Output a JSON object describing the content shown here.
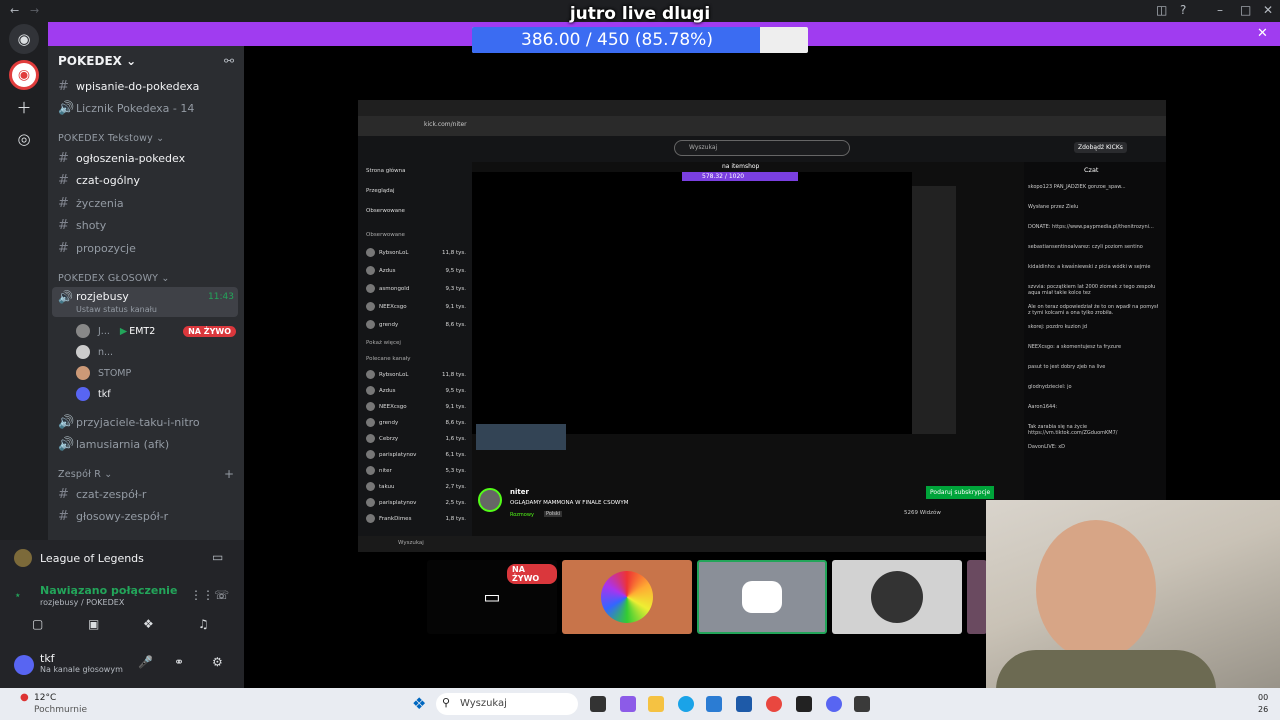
{
  "stream": {
    "title": "jutro live dlugi",
    "progress_text": "386.00 / 450 (85.78%)",
    "progress_fraction": 0.8578,
    "banner_color": "#a03cf0",
    "bar_color": "#3b6cf2",
    "overlay_tag": "POKEDEX"
  },
  "discord": {
    "server_name": "POKEDEX",
    "channels_top": [
      {
        "name": "wpisanie-do-pokedexa",
        "icon": "hash-icon"
      },
      {
        "name": "Licznik Pokedexa - 14",
        "icon": "voice-icon"
      }
    ],
    "text_category": "POKEDEX Tekstowy",
    "text_channels": [
      "ogłoszenia-pokedex",
      "czat-ogólny",
      "życzenia",
      "shoty",
      "propozycje"
    ],
    "voice_category": "POKEDEX GŁOSOWY",
    "voice_channel": {
      "name": "rozjebusy",
      "time": "11:43",
      "status": "Ustaw status kanału"
    },
    "voice_users": [
      {
        "name": "J...",
        "activity": "EMT2",
        "live": "NA ŻYWO"
      },
      {
        "name": "n..."
      },
      {
        "name": "STOMP"
      },
      {
        "name": "tkf"
      }
    ],
    "other_voice": [
      "przyjaciele-taku-i-nitro",
      "lamusiarnia (afk)"
    ],
    "zespol_category": "Zespół R",
    "zespol_channels": [
      "czat-zespół-r",
      "głosowy-zespół-r"
    ],
    "game_activity": "League of Legends",
    "connection": {
      "status": "Nawiązano połączenie",
      "detail": "rozjebusy / POKEDEX"
    },
    "user": {
      "name": "tkf",
      "status": "Na kanale głosowym"
    },
    "tile_live": "NA ŻYWO"
  },
  "kick": {
    "search_placeholder": "Wyszukaj",
    "url": "kick.com/niter",
    "get_kicks": "Zdobądź KICKs",
    "nav": [
      "Strona główna",
      "Przeglądaj",
      "Obserwowane"
    ],
    "followed_header": "Obserwowane",
    "followed": [
      {
        "name": "RybsonLoL",
        "game": "League of Legends",
        "viewers": "11,8 tys."
      },
      {
        "name": "Azdus",
        "game": "IRL",
        "viewers": "9,5 tys."
      },
      {
        "name": "asmongold",
        "game": "Rozmowy",
        "viewers": "9,3 tys."
      },
      {
        "name": "NEEXcsgo",
        "game": "Rozmowy",
        "viewers": "9,1 tys."
      },
      {
        "name": "grendy",
        "game": "Grand Theft Auto",
        "viewers": "8,6 tys."
      }
    ],
    "show_more": "Pokaż więcej",
    "recommended_header": "Polecane kanały",
    "recommended": [
      {
        "name": "RybsonLoL",
        "game": "League of Legends",
        "viewers": "11,8 tys."
      },
      {
        "name": "Azdus",
        "game": "IRL",
        "viewers": "9,5 tys."
      },
      {
        "name": "NEEXcsgo",
        "game": "Rozmowy",
        "viewers": "9,1 tys."
      },
      {
        "name": "grendy",
        "game": "Grand Theft Auto",
        "viewers": "8,6 tys."
      },
      {
        "name": "Cebrzy",
        "game": "Slots & Casino",
        "viewers": "1,6 tys."
      },
      {
        "name": "parisplatynov",
        "game": "Grand Theft Auto",
        "viewers": "6,1 tys."
      },
      {
        "name": "niter",
        "game": "Rozmowy",
        "viewers": "5,3 tys."
      },
      {
        "name": "takuu",
        "game": "Grand Theft Auto",
        "viewers": "2,7 tys."
      },
      {
        "name": "parisplatynov",
        "game": "Grand Theft Auto",
        "viewers": "2,5 tys."
      },
      {
        "name": "FrankDimes",
        "game": "Slots & Casino",
        "viewers": "1,8 tys."
      }
    ],
    "player_overlay": "na itemshop",
    "player_progress": "578.32 / 1020",
    "streamer": "niter",
    "stream_title": "OGLĄDAMY MAMMONA W FINALE CSOWYM",
    "category": "Rozmowy",
    "lang": "Polski",
    "subscribe": "Podaruj subskrypcje",
    "viewers": "5269 Widzów",
    "chat_title": "Czat",
    "chat_lines": [
      "skopo123  PAN_JADZIEK  gonzoe_spaw...",
      "Wysłane przez Zielu",
      "DONATE: https://www.paypmedia.pl/thenitrozyni...",
      "sebastiansentinoalvarez: czyli poziom sentino",
      "kidaidinho: a kwaśniewski z picia wódki w sejmie",
      "szvvia: początkiem lat 2000 ziomek z tego zespołu aqua miał takie kolce tez",
      "Ale on teraz odpowiedział że to on wpadł na pomysł z tymi kolcami a ona tylko zrobiła.",
      "skorej: pozdro kuzion jd",
      "NEEXcsgo: a skomentujesz ta fryzure",
      "pasut to jest dobry zjeb na live",
      "glodnydzieciel: jo",
      "Aaron1644:",
      "Tak zarabia się na życie https://vm.tiktok.com/ZGduomKM7/",
      "DavonLIVE: xD"
    ]
  },
  "taskbar": {
    "weather_temp": "12°C",
    "weather_desc": "Pochmurnie",
    "search": "Wyszukaj",
    "clock_a": "00",
    "clock_b": "26"
  }
}
